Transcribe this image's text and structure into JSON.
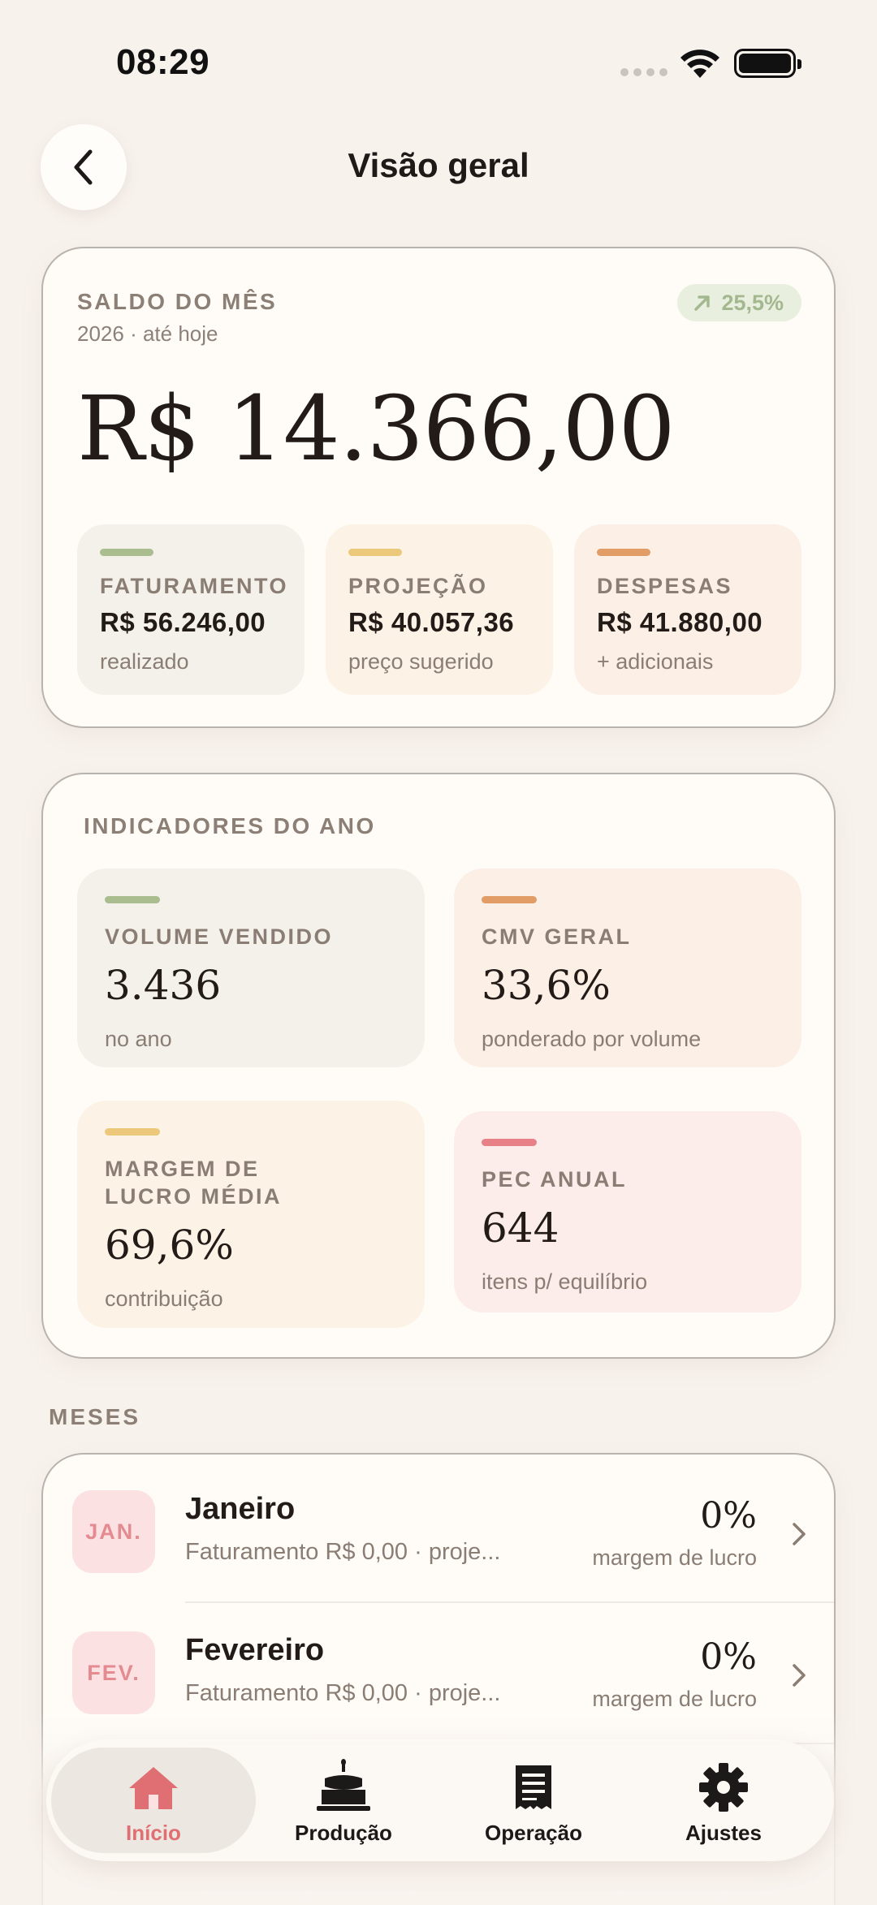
{
  "status": {
    "time": "08:29"
  },
  "header": {
    "title": "Visão geral"
  },
  "balance": {
    "label": "SALDO DO MÊS",
    "sub": "2026 · até hoje",
    "badge": "25,5%",
    "amount": "R$ 14.366,00",
    "tiles": [
      {
        "cap": "FATURAMENTO",
        "value": "R$ 56.246,00",
        "sub": "realizado",
        "color": "#a9bd8f",
        "bg": "#f4f1ea"
      },
      {
        "cap": "PROJEÇÃO",
        "value": "R$ 40.057,36",
        "sub": "preço sugerido",
        "color": "#ecc97a",
        "bg": "#fcf3e6"
      },
      {
        "cap": "DESPESAS",
        "value": "R$ 41.880,00",
        "sub": "+ adicionais",
        "color": "#e29c66",
        "bg": "#fbefe6"
      }
    ]
  },
  "indicators": {
    "title": "INDICADORES DO ANO",
    "items": [
      {
        "cap": "VOLUME VENDIDO",
        "value": "3.436",
        "sub": "no ano"
      },
      {
        "cap": "CMV GERAL",
        "value": "33,6%",
        "sub": "ponderado por volume"
      },
      {
        "cap1": "MARGEM DE",
        "cap2": "LUCRO MÉDIA",
        "value": "69,6%",
        "sub": "contribuição"
      },
      {
        "cap": "PEC ANUAL",
        "value": "644",
        "sub": "itens p/ equilíbrio"
      }
    ],
    "colors": [
      "#a9bd8f",
      "#e29c66",
      "#ecc97a",
      "#e88088"
    ]
  },
  "months": {
    "section_label": "MESES",
    "rows": [
      {
        "abbr": "JAN.",
        "name": "Janeiro",
        "sub": "Faturamento R$ 0,00 · proje...",
        "pct": "0%",
        "pct_label": "margem de lucro"
      },
      {
        "abbr": "FEV.",
        "name": "Fevereiro",
        "sub": "Faturamento R$ 0,00 · proje...",
        "pct": "0%",
        "pct_label": "margem de lucro"
      }
    ]
  },
  "tabbar": {
    "items": [
      {
        "label": "Início",
        "icon": "house-icon",
        "active": true
      },
      {
        "label": "Produção",
        "icon": "cake-icon"
      },
      {
        "label": "Operação",
        "icon": "receipt-icon"
      },
      {
        "label": "Ajustes",
        "icon": "gear-icon"
      }
    ],
    "active_color": "#e06f74"
  }
}
